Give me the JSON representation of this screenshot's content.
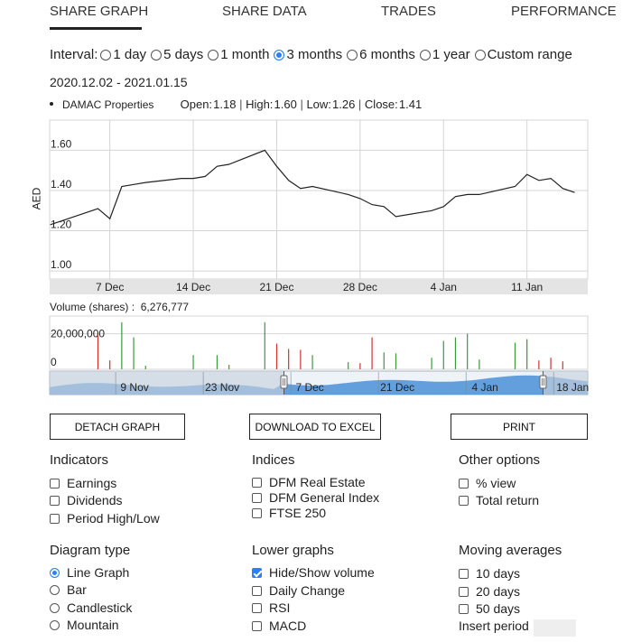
{
  "tabs": [
    {
      "label": "SHARE GRAPH",
      "active": true
    },
    {
      "label": "SHARE DATA",
      "active": false
    },
    {
      "label": "TRADES",
      "active": false
    },
    {
      "label": "PERFORMANCE",
      "active": false
    }
  ],
  "interval": {
    "label": "Interval:",
    "options": [
      "1 day",
      "5 days",
      "1 month",
      "3 months",
      "6 months",
      "1 year",
      "Custom range"
    ],
    "selected": "3 months"
  },
  "date_range": "2020.12.02 - 2021.01.15",
  "legend": {
    "name": "DAMAC Properties",
    "open_label": "Open:",
    "open": "1.18",
    "high_label": "High:",
    "high": "1.60",
    "low_label": "Low:",
    "low": "1.26",
    "close_label": "Close:",
    "close": "1.41"
  },
  "chart_data": [
    {
      "type": "line",
      "ylabel": "AED",
      "ylim": [
        0.96,
        1.75
      ],
      "yticks": [
        "1.60",
        "1.40",
        "1.20",
        "1.00"
      ],
      "xticks": [
        "7 Dec",
        "14 Dec",
        "21 Dec",
        "28 Dec",
        "4 Jan",
        "11 Jan"
      ],
      "grid": true,
      "x": [
        "2020-12-02",
        "2020-12-03",
        "2020-12-04",
        "2020-12-06",
        "2020-12-07",
        "2020-12-08",
        "2020-12-09",
        "2020-12-10",
        "2020-12-13",
        "2020-12-14",
        "2020-12-15",
        "2020-12-16",
        "2020-12-17",
        "2020-12-20",
        "2020-12-21",
        "2020-12-22",
        "2020-12-23",
        "2020-12-24",
        "2020-12-27",
        "2020-12-28",
        "2020-12-29",
        "2020-12-30",
        "2020-12-31",
        "2021-01-03",
        "2021-01-04",
        "2021-01-05",
        "2021-01-06",
        "2021-01-07",
        "2021-01-10",
        "2021-01-11",
        "2021-01-12",
        "2021-01-13",
        "2021-01-14",
        "2021-01-15"
      ],
      "y": [
        1.23,
        1.25,
        1.27,
        1.31,
        1.26,
        1.42,
        1.43,
        1.44,
        1.46,
        1.46,
        1.47,
        1.52,
        1.53,
        1.6,
        1.52,
        1.45,
        1.41,
        1.42,
        1.38,
        1.36,
        1.33,
        1.32,
        1.27,
        1.3,
        1.32,
        1.37,
        1.38,
        1.38,
        1.42,
        1.48,
        1.45,
        1.46,
        1.41,
        1.39
      ]
    },
    {
      "type": "bar",
      "title": "Volume (shares) :",
      "total": "6,276,777",
      "yticks": [
        "20,000,000",
        "0"
      ],
      "ylim": [
        0,
        30000000
      ],
      "x": [
        "2020-12-06",
        "2020-12-07",
        "2020-12-08",
        "2020-12-09",
        "2020-12-10",
        "2020-12-14",
        "2020-12-16",
        "2020-12-17",
        "2020-12-20",
        "2020-12-21",
        "2020-12-22",
        "2020-12-23",
        "2020-12-24",
        "2020-12-27",
        "2020-12-28",
        "2020-12-29",
        "2020-12-30",
        "2020-12-31",
        "2021-01-03",
        "2021-01-04",
        "2021-01-05",
        "2021-01-06",
        "2021-01-07",
        "2021-01-10",
        "2021-01-11",
        "2021-01-12",
        "2021-01-13",
        "2021-01-14"
      ],
      "values": [
        19000000,
        5000000,
        26500000,
        18000000,
        2000000,
        8000000,
        8000000,
        2500000,
        26500000,
        14500000,
        11500000,
        11000000,
        8000000,
        4000000,
        3500000,
        18000000,
        9500000,
        9000000,
        6500000,
        16000000,
        18000000,
        20000000,
        5500000,
        15000000,
        17000000,
        5000000,
        6500000,
        4500000
      ],
      "colors": [
        "red",
        "red",
        "green",
        "green",
        "green",
        "green",
        "green",
        "green",
        "green",
        "red",
        "red",
        "red",
        "green",
        "green",
        "red",
        "red",
        "green",
        "green",
        "green",
        "green",
        "green",
        "green",
        "green",
        "green",
        "green",
        "red",
        "red",
        "red"
      ]
    }
  ],
  "navigator": {
    "labels": [
      "9 Nov",
      "23 Nov",
      "7 Dec",
      "21 Dec",
      "4 Jan",
      "18 Jan"
    ],
    "selection_start": "2020-12-02",
    "selection_end": "2021-01-15"
  },
  "buttons": {
    "detach": "DETACH GRAPH",
    "download": "DOWNLOAD TO EXCEL",
    "print": "PRINT"
  },
  "indicators": {
    "title": "Indicators",
    "items": [
      {
        "label": "Earnings",
        "checked": false
      },
      {
        "label": "Dividends",
        "checked": false
      },
      {
        "label": "Period High/Low",
        "checked": false
      }
    ]
  },
  "indices": {
    "title": "Indices",
    "items": [
      {
        "label": "DFM Real Estate",
        "checked": false
      },
      {
        "label": "DFM General Index",
        "checked": false
      },
      {
        "label": "FTSE 250",
        "checked": false
      }
    ]
  },
  "other_options": {
    "title": "Other options",
    "items": [
      {
        "label": "% view",
        "checked": false
      },
      {
        "label": "Total return",
        "checked": false
      }
    ]
  },
  "diagram_type": {
    "title": "Diagram type",
    "items": [
      {
        "label": "Line Graph",
        "checked": true
      },
      {
        "label": "Bar",
        "checked": false
      },
      {
        "label": "Candlestick",
        "checked": false
      },
      {
        "label": "Mountain",
        "checked": false
      }
    ]
  },
  "lower_graphs": {
    "title": "Lower graphs",
    "items": [
      {
        "label": "Hide/Show volume",
        "checked": true
      },
      {
        "label": "Daily Change",
        "checked": false
      },
      {
        "label": "RSI",
        "checked": false
      },
      {
        "label": "MACD",
        "checked": false
      }
    ]
  },
  "moving_averages": {
    "title": "Moving averages",
    "items": [
      {
        "label": "10 days",
        "checked": false
      },
      {
        "label": "20 days",
        "checked": false
      },
      {
        "label": "50 days",
        "checked": false
      }
    ],
    "insert_period_label": "Insert period",
    "insert_period_value": ""
  },
  "colors": {
    "accent": "#2d7ff9",
    "line": "#222222",
    "grid": "#d4d4d4",
    "up_bar": "#3a9a3a",
    "down_bar": "#d0342c",
    "navigator_fill": "#4a8fd8",
    "navigator_mask": "#c8d1db",
    "xaxis_band": "#e4e4e4"
  }
}
